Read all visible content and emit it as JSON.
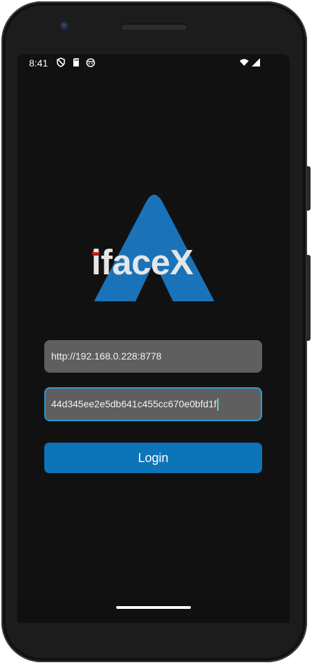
{
  "status_bar": {
    "time": "8:41",
    "left_icons": [
      "shield-icon",
      "sd-card-icon",
      "notification-app-icon"
    ],
    "right_icons": [
      "wifi-icon",
      "cell-signal-icon"
    ]
  },
  "logo": {
    "text": "ifaceX",
    "colors": {
      "mark": "#1a73b8",
      "text": "#e6e6e6",
      "dot": "#b71c1c"
    }
  },
  "form": {
    "server_url": {
      "value": "http://192.168.0.228:8778"
    },
    "token": {
      "value": "44d345ee2e5db641c455cc670e0bfd1f",
      "focused": true
    },
    "login_label": "Login"
  },
  "colors": {
    "screen_bg": "#111111",
    "field_bg": "#5f5f5f",
    "focus_border": "#2a9bd8",
    "button_bg": "#0e74b8"
  }
}
